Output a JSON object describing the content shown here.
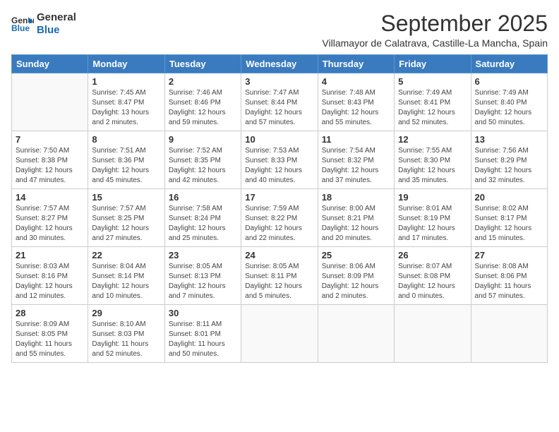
{
  "logo": {
    "line1": "General",
    "line2": "Blue"
  },
  "title": "September 2025",
  "subtitle": "Villamayor de Calatrava, Castille-La Mancha, Spain",
  "weekdays": [
    "Sunday",
    "Monday",
    "Tuesday",
    "Wednesday",
    "Thursday",
    "Friday",
    "Saturday"
  ],
  "weeks": [
    [
      {
        "day": "",
        "info": ""
      },
      {
        "day": "1",
        "info": "Sunrise: 7:45 AM\nSunset: 8:47 PM\nDaylight: 13 hours\nand 2 minutes."
      },
      {
        "day": "2",
        "info": "Sunrise: 7:46 AM\nSunset: 8:46 PM\nDaylight: 12 hours\nand 59 minutes."
      },
      {
        "day": "3",
        "info": "Sunrise: 7:47 AM\nSunset: 8:44 PM\nDaylight: 12 hours\nand 57 minutes."
      },
      {
        "day": "4",
        "info": "Sunrise: 7:48 AM\nSunset: 8:43 PM\nDaylight: 12 hours\nand 55 minutes."
      },
      {
        "day": "5",
        "info": "Sunrise: 7:49 AM\nSunset: 8:41 PM\nDaylight: 12 hours\nand 52 minutes."
      },
      {
        "day": "6",
        "info": "Sunrise: 7:49 AM\nSunset: 8:40 PM\nDaylight: 12 hours\nand 50 minutes."
      }
    ],
    [
      {
        "day": "7",
        "info": "Sunrise: 7:50 AM\nSunset: 8:38 PM\nDaylight: 12 hours\nand 47 minutes."
      },
      {
        "day": "8",
        "info": "Sunrise: 7:51 AM\nSunset: 8:36 PM\nDaylight: 12 hours\nand 45 minutes."
      },
      {
        "day": "9",
        "info": "Sunrise: 7:52 AM\nSunset: 8:35 PM\nDaylight: 12 hours\nand 42 minutes."
      },
      {
        "day": "10",
        "info": "Sunrise: 7:53 AM\nSunset: 8:33 PM\nDaylight: 12 hours\nand 40 minutes."
      },
      {
        "day": "11",
        "info": "Sunrise: 7:54 AM\nSunset: 8:32 PM\nDaylight: 12 hours\nand 37 minutes."
      },
      {
        "day": "12",
        "info": "Sunrise: 7:55 AM\nSunset: 8:30 PM\nDaylight: 12 hours\nand 35 minutes."
      },
      {
        "day": "13",
        "info": "Sunrise: 7:56 AM\nSunset: 8:29 PM\nDaylight: 12 hours\nand 32 minutes."
      }
    ],
    [
      {
        "day": "14",
        "info": "Sunrise: 7:57 AM\nSunset: 8:27 PM\nDaylight: 12 hours\nand 30 minutes."
      },
      {
        "day": "15",
        "info": "Sunrise: 7:57 AM\nSunset: 8:25 PM\nDaylight: 12 hours\nand 27 minutes."
      },
      {
        "day": "16",
        "info": "Sunrise: 7:58 AM\nSunset: 8:24 PM\nDaylight: 12 hours\nand 25 minutes."
      },
      {
        "day": "17",
        "info": "Sunrise: 7:59 AM\nSunset: 8:22 PM\nDaylight: 12 hours\nand 22 minutes."
      },
      {
        "day": "18",
        "info": "Sunrise: 8:00 AM\nSunset: 8:21 PM\nDaylight: 12 hours\nand 20 minutes."
      },
      {
        "day": "19",
        "info": "Sunrise: 8:01 AM\nSunset: 8:19 PM\nDaylight: 12 hours\nand 17 minutes."
      },
      {
        "day": "20",
        "info": "Sunrise: 8:02 AM\nSunset: 8:17 PM\nDaylight: 12 hours\nand 15 minutes."
      }
    ],
    [
      {
        "day": "21",
        "info": "Sunrise: 8:03 AM\nSunset: 8:16 PM\nDaylight: 12 hours\nand 12 minutes."
      },
      {
        "day": "22",
        "info": "Sunrise: 8:04 AM\nSunset: 8:14 PM\nDaylight: 12 hours\nand 10 minutes."
      },
      {
        "day": "23",
        "info": "Sunrise: 8:05 AM\nSunset: 8:13 PM\nDaylight: 12 hours\nand 7 minutes."
      },
      {
        "day": "24",
        "info": "Sunrise: 8:05 AM\nSunset: 8:11 PM\nDaylight: 12 hours\nand 5 minutes."
      },
      {
        "day": "25",
        "info": "Sunrise: 8:06 AM\nSunset: 8:09 PM\nDaylight: 12 hours\nand 2 minutes."
      },
      {
        "day": "26",
        "info": "Sunrise: 8:07 AM\nSunset: 8:08 PM\nDaylight: 12 hours\nand 0 minutes."
      },
      {
        "day": "27",
        "info": "Sunrise: 8:08 AM\nSunset: 8:06 PM\nDaylight: 11 hours\nand 57 minutes."
      }
    ],
    [
      {
        "day": "28",
        "info": "Sunrise: 8:09 AM\nSunset: 8:05 PM\nDaylight: 11 hours\nand 55 minutes."
      },
      {
        "day": "29",
        "info": "Sunrise: 8:10 AM\nSunset: 8:03 PM\nDaylight: 11 hours\nand 52 minutes."
      },
      {
        "day": "30",
        "info": "Sunrise: 8:11 AM\nSunset: 8:01 PM\nDaylight: 11 hours\nand 50 minutes."
      },
      {
        "day": "",
        "info": ""
      },
      {
        "day": "",
        "info": ""
      },
      {
        "day": "",
        "info": ""
      },
      {
        "day": "",
        "info": ""
      }
    ]
  ]
}
